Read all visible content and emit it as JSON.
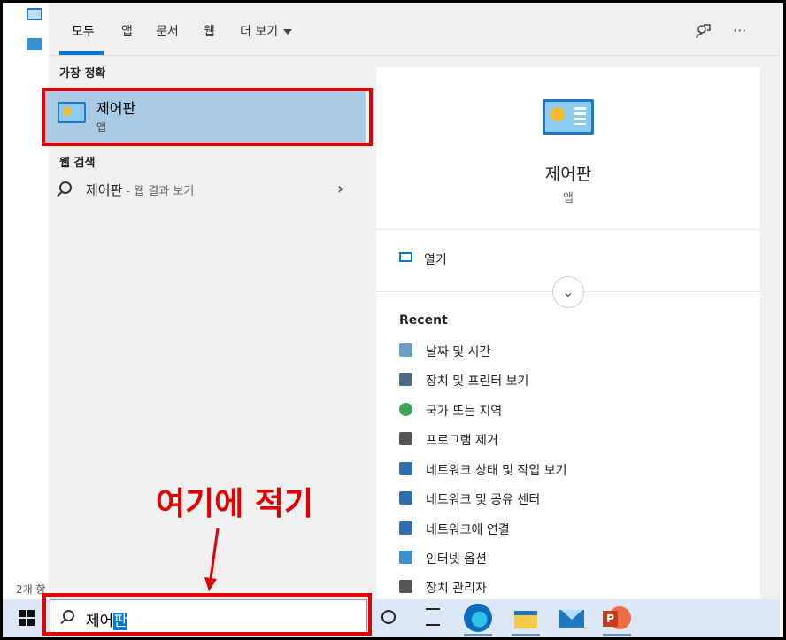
{
  "desktop": {
    "count_label": "2개 항"
  },
  "tabs": [
    {
      "label": "모두",
      "active": true
    },
    {
      "label": "앱"
    },
    {
      "label": "문서"
    },
    {
      "label": "웹"
    },
    {
      "label": "더 보기"
    }
  ],
  "top_icons": {
    "feedback": "feedback-icon",
    "more": "···"
  },
  "best_match": {
    "section_title": "가장 정확",
    "name": "제어판",
    "type": "앱",
    "icon": "control-panel-icon"
  },
  "web_search": {
    "section_title": "웹 검색",
    "term": "제어판",
    "sub": "- 웹 결과 보기"
  },
  "preview": {
    "name": "제어판",
    "type": "앱",
    "open_label": "열기",
    "recent_title": "Recent",
    "recent_items": [
      {
        "label": "날짜 및 시간",
        "icon": "clock-icon",
        "color": "#6aa0c8"
      },
      {
        "label": "장치 및 프린터 보기",
        "icon": "printer-icon",
        "color": "#4a6a86"
      },
      {
        "label": "국가 또는 지역",
        "icon": "globe-icon",
        "color": "#3aa35a"
      },
      {
        "label": "프로그램 제거",
        "icon": "program-icon",
        "color": "#555555"
      },
      {
        "label": "네트워크 상태 및 작업 보기",
        "icon": "network-icon",
        "color": "#2f6fb0"
      },
      {
        "label": "네트워크 및 공유 센터",
        "icon": "network-icon",
        "color": "#2f6fb0"
      },
      {
        "label": "네트워크에 연결",
        "icon": "network-icon",
        "color": "#2f6fb0"
      },
      {
        "label": "인터넷 옵션",
        "icon": "internet-options-icon",
        "color": "#3a8fd0"
      },
      {
        "label": "장치 관리자",
        "icon": "device-manager-icon",
        "color": "#555555"
      }
    ]
  },
  "taskbar": {
    "search_typed": "제어",
    "search_selected": "판",
    "apps": [
      "edge",
      "file-explorer",
      "mail",
      "powerpoint"
    ]
  },
  "annotation": {
    "text": "여기에 적기",
    "color": "#e00000"
  }
}
